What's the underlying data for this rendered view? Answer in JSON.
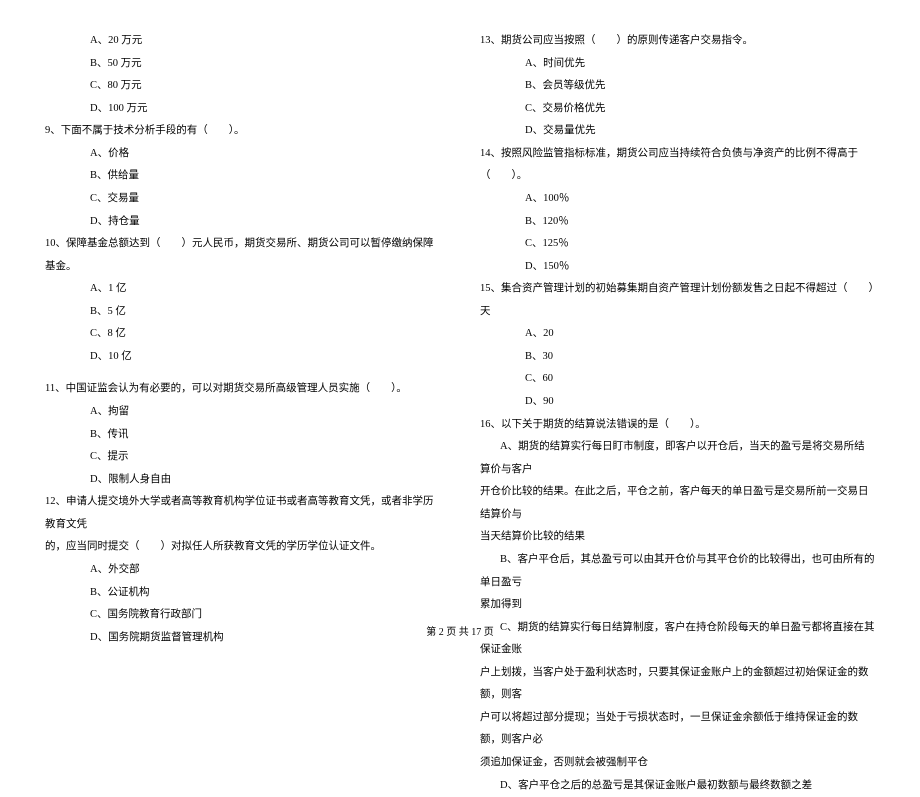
{
  "left": {
    "q8_options": [
      "A、20 万元",
      "B、50 万元",
      "C、80 万元",
      "D、100 万元"
    ],
    "q9": "9、下面不属于技术分析手段的有（　　）。",
    "q9_options": [
      "A、价格",
      "B、供给量",
      "C、交易量",
      "D、持仓量"
    ],
    "q10": "10、保障基金总额达到（　　）元人民币，期货交易所、期货公司可以暂停缴纳保障基金。",
    "q10_options": [
      "A、1 亿",
      "B、5 亿",
      "C、8 亿",
      "D、10 亿"
    ],
    "q11": "11、中国证监会认为有必要的，可以对期货交易所高级管理人员实施（　　）。",
    "q11_options": [
      "A、拘留",
      "B、传讯",
      "C、提示",
      "D、限制人身自由"
    ],
    "q12_line1": "12、申请人提交境外大学或者高等教育机构学位证书或者高等教育文凭，或者非学历教育文凭",
    "q12_line2": "的，应当同时提交（　　）对拟任人所获教育文凭的学历学位认证文件。",
    "q12_options": [
      "A、外交部",
      "B、公证机构",
      "C、国务院教育行政部门",
      "D、国务院期货监督管理机构"
    ]
  },
  "right": {
    "q13": "13、期货公司应当按照（　　）的原则传递客户交易指令。",
    "q13_options": [
      "A、时间优先",
      "B、会员等级优先",
      "C、交易价格优先",
      "D、交易量优先"
    ],
    "q14": "14、按照风险监管指标标准，期货公司应当持续符合负债与净资产的比例不得高于（　　）。",
    "q14_options": [
      "A、100％",
      "B、120％",
      "C、125％",
      "D、150％"
    ],
    "q15": "15、集合资产管理计划的初始募集期自资产管理计划份额发售之日起不得超过（　　）天",
    "q15_options": [
      "A、20",
      "B、30",
      "C、60",
      "D、90"
    ],
    "q16": "16、以下关于期货的结算说法错误的是（　　）。",
    "q16_a1": "A、期货的结算实行每日盯市制度，即客户以开仓后，当天的盈亏是将交易所结算价与客户",
    "q16_a2": "开仓价比较的结果。在此之后，平仓之前，客户每天的单日盈亏是交易所前一交易日结算价与",
    "q16_a3": "当天结算价比较的结果",
    "q16_b1": "B、客户平仓后，其总盈亏可以由其开仓价与其平仓价的比较得出，也可由所有的单日盈亏",
    "q16_b2": "累加得到",
    "q16_c1": "C、期货的结算实行每日结算制度，客户在持仓阶段每天的单日盈亏都将直接在其保证金账",
    "q16_c2": "户上划拨，当客户处于盈利状态时，只要其保证金账户上的金额超过初始保证金的数额，则客",
    "q16_c3": "户可以将超过部分提现；当处于亏损状态时，一旦保证金余额低于维持保证金的数额，则客户必",
    "q16_c4": "须追加保证金，否则就会被强制平仓",
    "q16_d": "D、客户平仓之后的总盈亏是其保证金账户最初数额与最终数额之差"
  },
  "footer": "第 2 页 共 17 页"
}
